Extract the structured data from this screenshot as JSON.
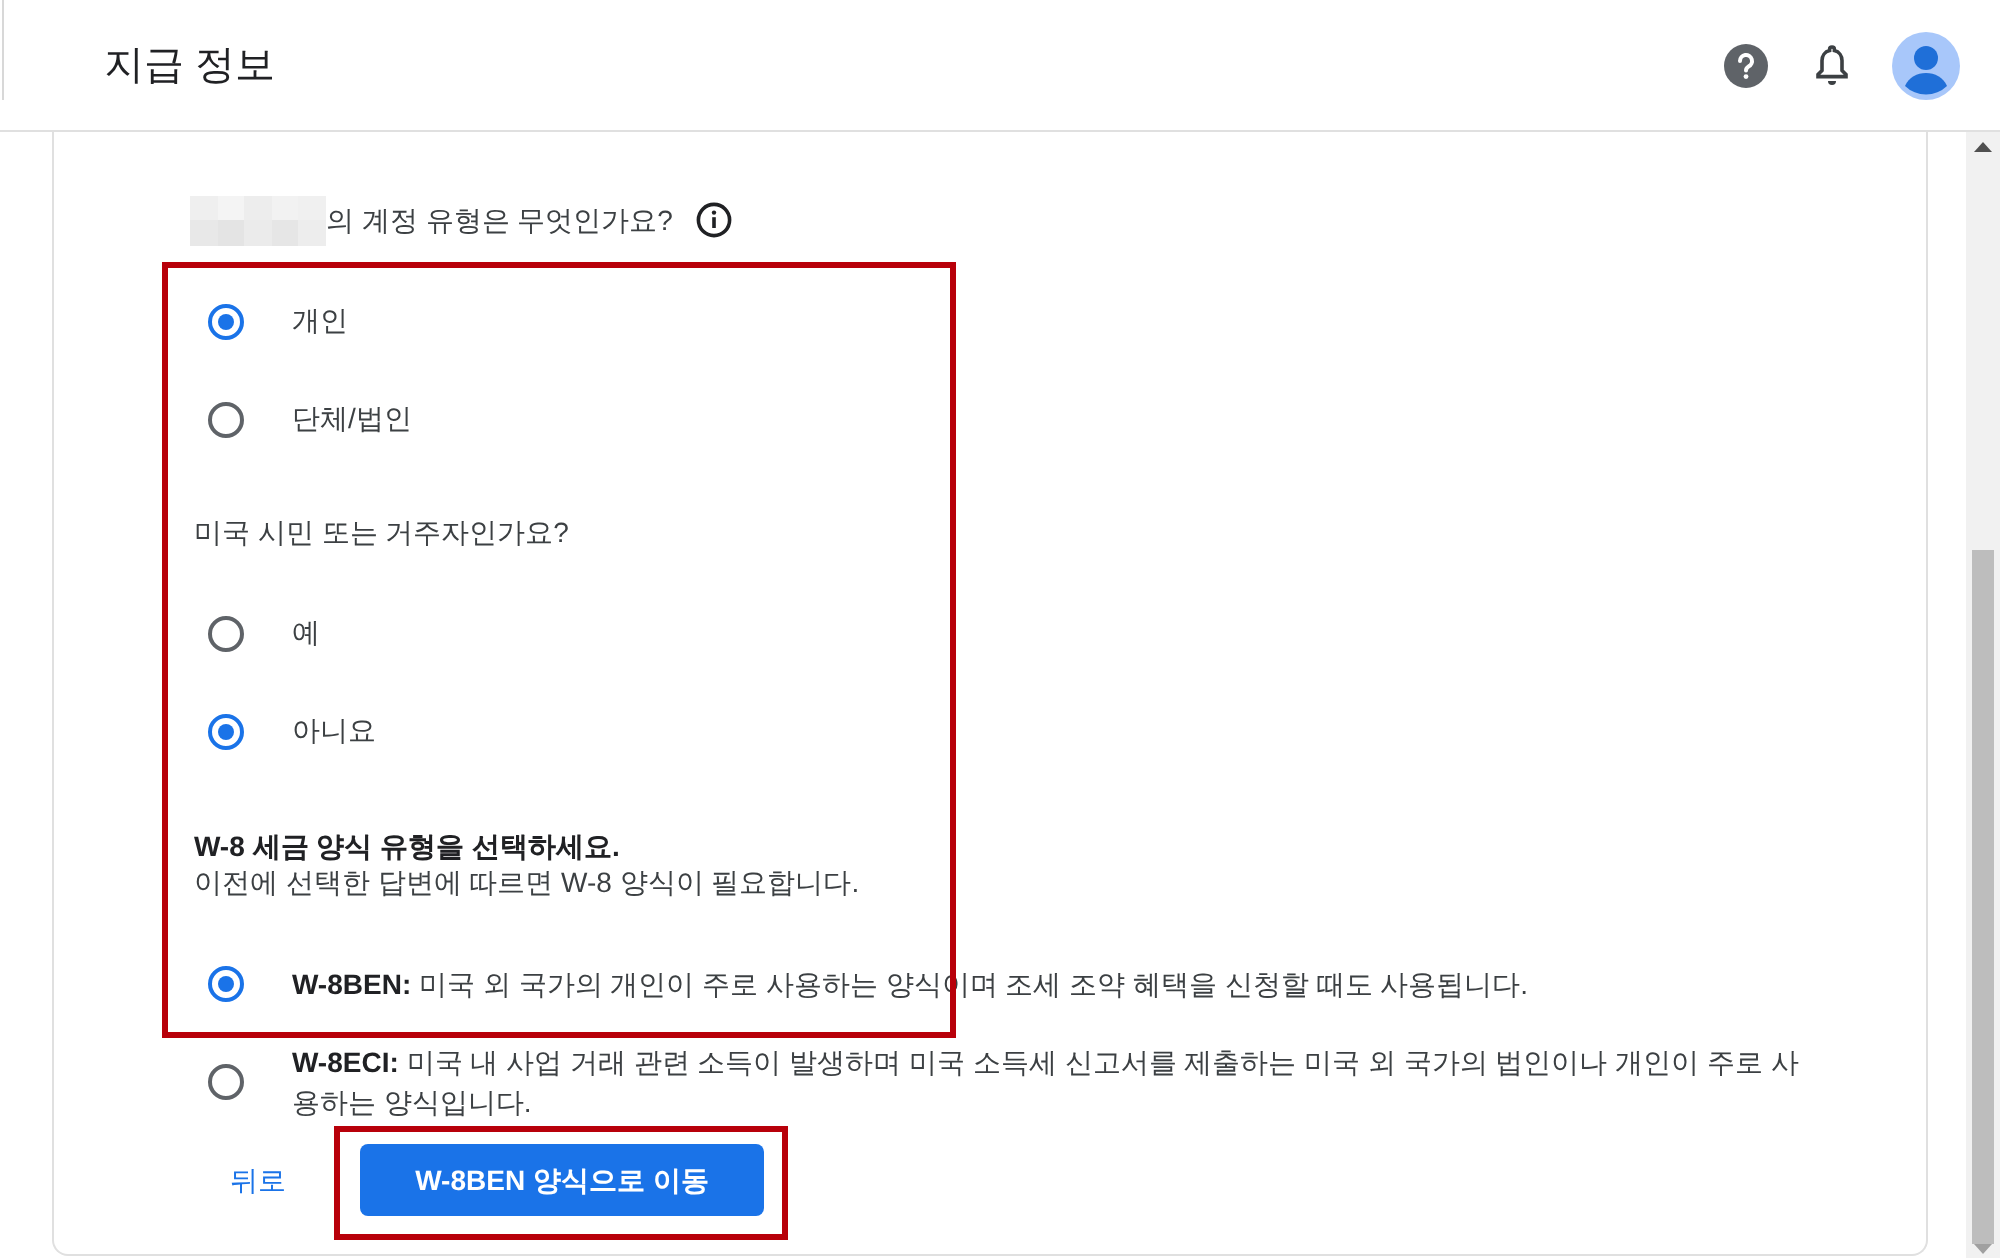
{
  "header": {
    "title": "지급 정보"
  },
  "account_question": {
    "text": "의 계정 유형은 무엇인가요?"
  },
  "account_type_options": [
    {
      "label": "개인",
      "selected": true
    },
    {
      "label": "단체/법인",
      "selected": false
    }
  ],
  "residency_question": {
    "text": "미국 시민 또는 거주자인가요?"
  },
  "residency_options": [
    {
      "label": "예",
      "selected": false
    },
    {
      "label": "아니요",
      "selected": true
    }
  ],
  "form_type": {
    "title": "W-8 세금 양식 유형을 선택하세요.",
    "subtitle": "이전에 선택한 답변에 따르면 W-8 양식이 필요합니다.",
    "options": [
      {
        "label": "**W-8BEN:** 미국 외 국가의 개인이 주로 사용하는 양식이며 조세 조약 혜택을 신청할 때도 사용됩니다.",
        "selected": true
      },
      {
        "label": "**W-8ECI:** 미국 내 사업 거래 관련 소득이 발생하며 미국 소득세 신고서를 제출하는 미국 외 국가의 법인이나 개인이 주로 사용하는 양식입니다.",
        "selected": false
      }
    ]
  },
  "actions": {
    "back": "뒤로",
    "primary": "W-8BEN 양식으로 이동"
  }
}
